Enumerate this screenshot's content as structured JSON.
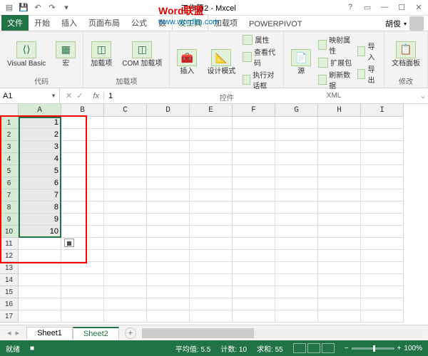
{
  "window": {
    "title_left": "工作簿2 - M",
    "title_right": "xcel"
  },
  "watermark": {
    "brand1": "Word",
    "brand2": "联盟",
    "url": "www.wordlm.com"
  },
  "tabs": {
    "file": "文件",
    "start": "开始",
    "insert": "插入",
    "layout": "页面布局",
    "formulas": "公式",
    "data": "数",
    "review": "",
    "view": "",
    "dev": "发工具",
    "addins": "加载项",
    "powerpivot": "POWERPIVOT",
    "user": "胡俊"
  },
  "ribbon": {
    "g1": {
      "vb": "Visual Basic",
      "macro": "宏",
      "label": "代码"
    },
    "g2": {
      "addins": "加载项",
      "com": "COM 加载项",
      "label": "加载项"
    },
    "g3": {
      "insert": "插入",
      "design": "设计模式",
      "props": "属性",
      "code": "查看代码",
      "dialog": "执行对话框",
      "label": "控件"
    },
    "g4": {
      "source": "源",
      "map": "映射属性",
      "expand": "扩展包",
      "refresh": "刷新数据",
      "import": "导入",
      "export": "导出",
      "label": "XML"
    },
    "g5": {
      "panel": "文档面板",
      "label": "修改"
    }
  },
  "namebox": "A1",
  "formula": "1",
  "cols": [
    "A",
    "B",
    "C",
    "D",
    "E",
    "F",
    "G",
    "H",
    "I"
  ],
  "rows": [
    1,
    2,
    3,
    4,
    5,
    6,
    7,
    8,
    9,
    10,
    11,
    12,
    13,
    14,
    15,
    16,
    17
  ],
  "cell_values": [
    1,
    2,
    3,
    4,
    5,
    6,
    7,
    8,
    9,
    10
  ],
  "sheets": {
    "s1": "Sheet1",
    "s2": "Sheet2"
  },
  "status": {
    "ready": "就绪",
    "rec": "",
    "avg": "平均值: 5.5",
    "count": "计数: 10",
    "sum": "求和: 55",
    "zoom": "100%"
  }
}
